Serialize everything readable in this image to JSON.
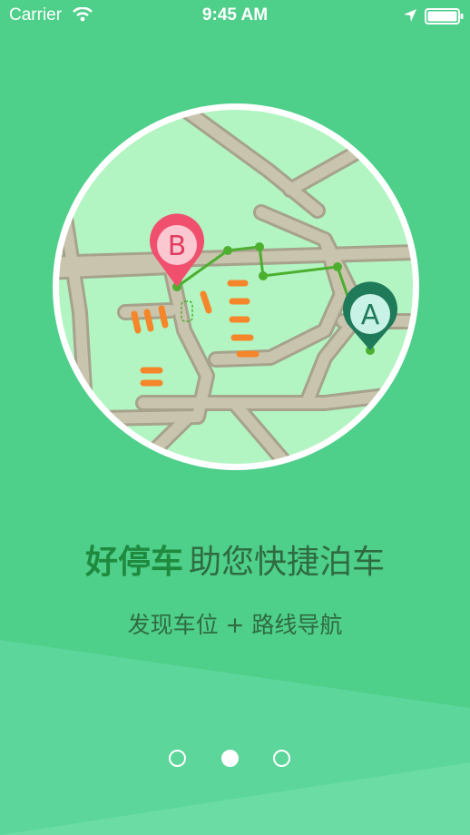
{
  "status_bar": {
    "carrier": "Carrier",
    "time": "9:45 AM"
  },
  "map": {
    "marker_start": "A",
    "marker_end": "B"
  },
  "headline": {
    "brand": "好停车",
    "text": "助您快捷泊车"
  },
  "subline": "发现车位 + 路线导航",
  "pager": {
    "count": 3,
    "active_index": 1
  },
  "colors": {
    "background": "#4ecf8a",
    "map_land": "#b2f5c2",
    "road": "#c9c4ad",
    "route": "#4caf2e",
    "parking_slot": "#f5862a",
    "marker_b": "#f0506e",
    "marker_a": "#1f7a5a"
  },
  "icons": [
    "wifi-icon",
    "location-arrow-icon",
    "battery-icon",
    "marker-a-icon",
    "marker-b-icon"
  ]
}
